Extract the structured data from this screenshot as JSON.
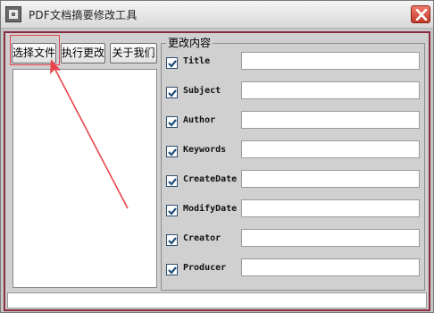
{
  "window": {
    "title": "PDF文档摘要修改工具",
    "icons": {
      "app": "app-icon",
      "close": "close-icon"
    }
  },
  "toolbar": {
    "select_file": "选择文件",
    "execute_change": "执行更改",
    "about_us": "关于我们"
  },
  "metadata_panel": {
    "group_title": "更改内容",
    "fields": [
      {
        "label": "Title",
        "checked": true,
        "value": ""
      },
      {
        "label": "Subject",
        "checked": true,
        "value": ""
      },
      {
        "label": "Author",
        "checked": true,
        "value": ""
      },
      {
        "label": "Keywords",
        "checked": true,
        "value": ""
      },
      {
        "label": "CreateDate",
        "checked": true,
        "value": ""
      },
      {
        "label": "ModifyDate",
        "checked": true,
        "value": ""
      },
      {
        "label": "Creator",
        "checked": true,
        "value": ""
      },
      {
        "label": "Producer",
        "checked": true,
        "value": ""
      }
    ]
  },
  "file_list": {
    "items": []
  },
  "status_bar": {
    "text": ""
  },
  "colors": {
    "annotation_red": "#e8444c",
    "client_border": "#8b2b3f",
    "close_button": "#c23a2b",
    "checkbox_check": "#1e4d78"
  }
}
